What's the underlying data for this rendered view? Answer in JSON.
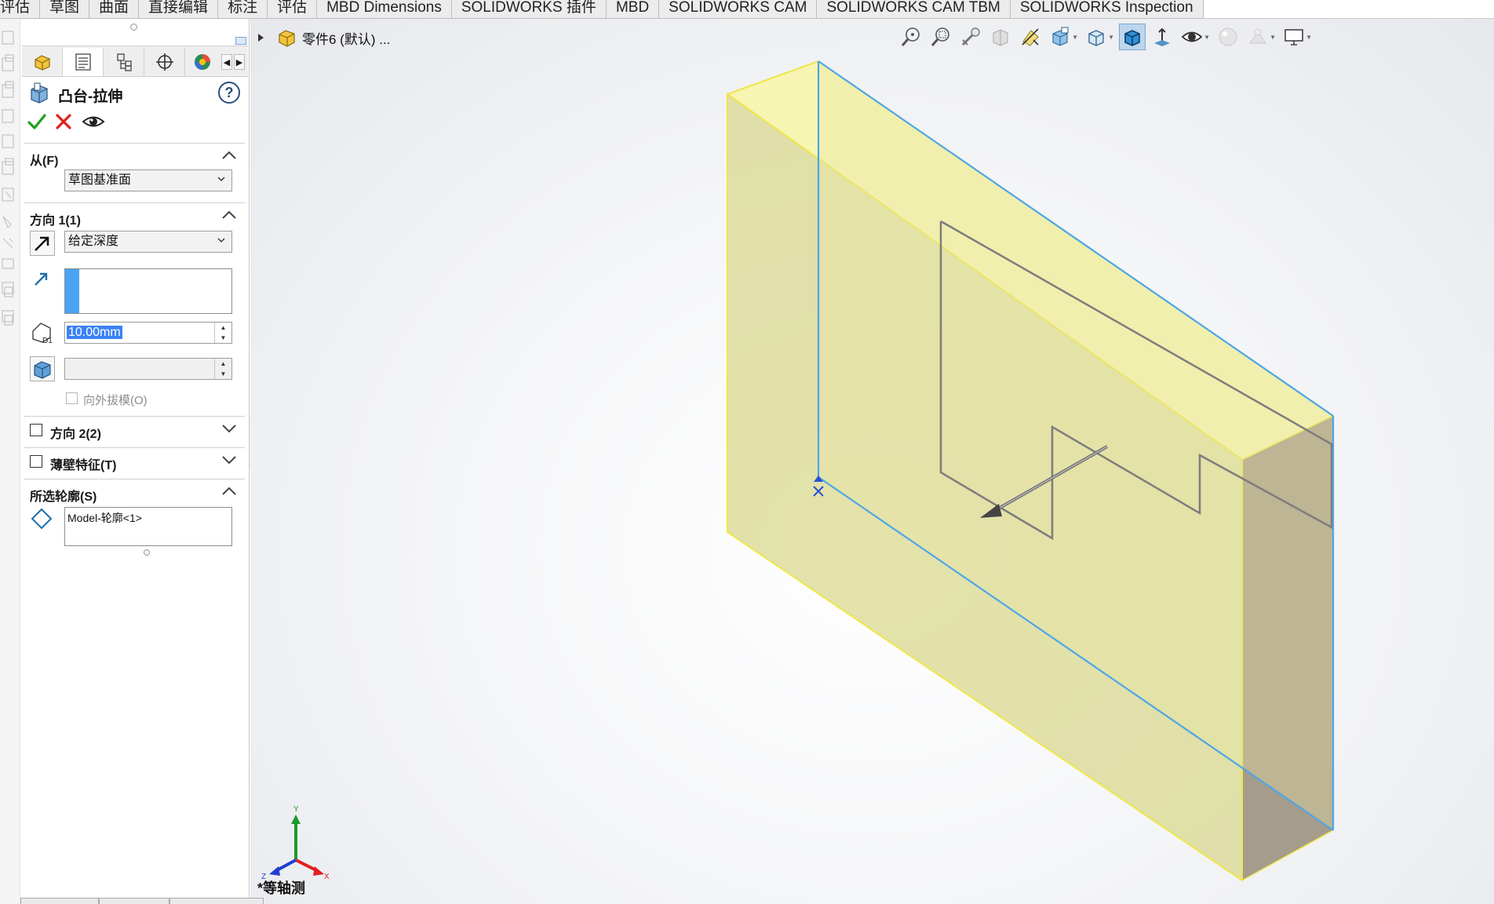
{
  "ribbon": {
    "tabs": [
      "评估",
      "草图",
      "曲面",
      "直接编辑",
      "标注",
      "评估",
      "MBD Dimensions",
      "SOLIDWORKS 插件",
      "MBD",
      "SOLIDWORKS CAM",
      "SOLIDWORKS CAM TBM",
      "SOLIDWORKS Inspection"
    ]
  },
  "feature_manager": {
    "title": "凸台-拉伸",
    "help_symbol": "?",
    "from": {
      "header": "从(F)",
      "selected": "草图基准面"
    },
    "direction1": {
      "header": "方向 1(1)",
      "end_condition": "给定深度",
      "depth_value": "10.00mm",
      "draft_outward_label": "向外拔模(O)"
    },
    "direction2": {
      "header": "方向 2(2)",
      "checked": false
    },
    "thin_feature": {
      "header": "薄壁特征(T)",
      "checked": false
    },
    "selected_contours": {
      "header": "所选轮廓(S)",
      "items": [
        "Model-轮廓<1>"
      ]
    }
  },
  "graphics": {
    "part_name": "零件6 (默认) ...",
    "view_orientation": "*等轴测",
    "triad_labels": {
      "x": "X",
      "y": "Y",
      "z": "Z"
    },
    "colors": {
      "preview_face": "#f4f3a4",
      "preview_edge": "#f0e84a",
      "model_edge": "#4da6e8",
      "sketch_line": "#7d7d7d",
      "side_face": "#a89e8d"
    }
  },
  "icons": {
    "toolbar": [
      "zoom-to-fit-icon",
      "zoom-area-icon",
      "previous-view-icon",
      "section-view-icon",
      "dynamic-annotation-icon",
      "view-orientation-icon",
      "display-style-icon",
      "shaded-edges-icon",
      "hide-show-icon",
      "edit-appearance-icon",
      "apply-scene-icon",
      "view-settings-icon"
    ]
  }
}
